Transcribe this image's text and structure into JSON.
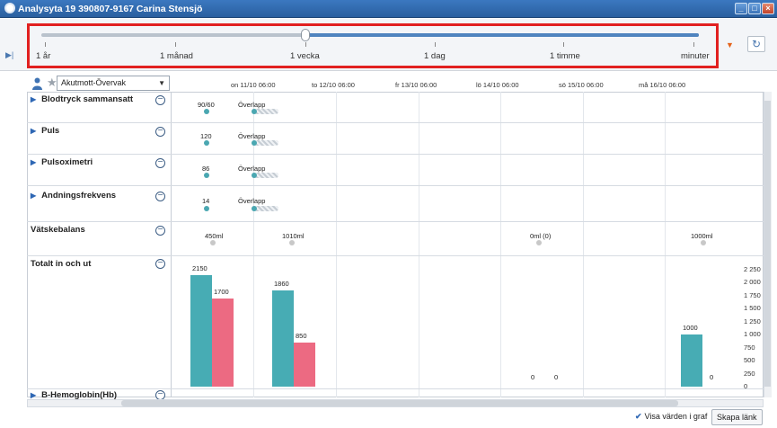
{
  "window": {
    "title": "Analysyta 19 390807-9167 Carina Stensjö"
  },
  "timeline": {
    "scale": [
      "1 år",
      "1 månad",
      "1 vecka",
      "1 dag",
      "1 timme",
      "minuter"
    ],
    "position_fraction": 0.4
  },
  "filter": {
    "profile": "Akutmott-Övervak"
  },
  "dates": [
    "on 11/10 06:00",
    "to 12/10 06:00",
    "fr 13/10 06:00",
    "lö 14/10 06:00",
    "sö 15/10 06:00",
    "må 16/10 06:00"
  ],
  "rows": {
    "blodtryck": {
      "label": "Blodtryck sammansatt",
      "value": "90/60",
      "overlap": "Överlapp"
    },
    "puls": {
      "label": "Puls",
      "value": "120",
      "overlap": "Överlapp"
    },
    "pulsoximetri": {
      "label": "Pulsoximetri",
      "value": "86",
      "overlap": "Överlapp"
    },
    "andning": {
      "label": "Andningsfrekvens",
      "value": "14",
      "overlap": "Överlapp"
    },
    "vatskebalans": {
      "label": "Vätskebalans",
      "values": [
        "450ml",
        "1010ml",
        "0ml (0)",
        "1000ml"
      ]
    },
    "totalt": {
      "label": "Totalt in och ut"
    },
    "hemoglobin": {
      "label": "B-Hemoglobin(Hb)"
    }
  },
  "chart_data": {
    "type": "bar",
    "series": [
      {
        "name": "in",
        "color": "#47acb4",
        "values": [
          2150,
          1860,
          0,
          1000
        ]
      },
      {
        "name": "ut",
        "color": "#ec6a82",
        "values": [
          1700,
          850,
          0,
          0
        ]
      }
    ],
    "ylim": [
      0,
      2250
    ],
    "yticks": [
      "2 250",
      "2 000",
      "1 750",
      "1 500",
      "1 250",
      "1 000",
      "750",
      "500",
      "250",
      "0"
    ],
    "bar_labels": [
      "2150",
      "1700",
      "1860",
      "850",
      "0",
      "0",
      "1000",
      "0"
    ]
  },
  "footer": {
    "show_values_label": "Visa värden i graf",
    "create_link_label": "Skapa länk"
  },
  "icons": {
    "refresh": "↻",
    "minus": "−"
  }
}
